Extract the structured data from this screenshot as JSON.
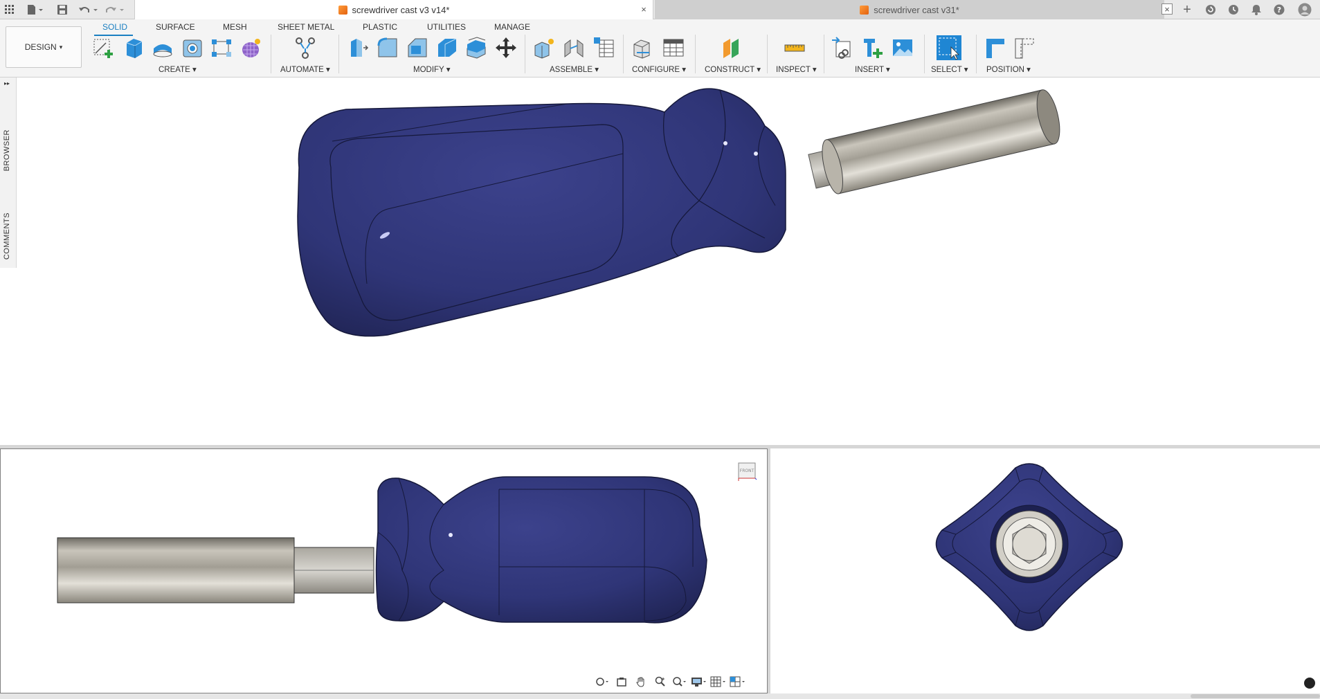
{
  "window": {
    "tabs": [
      {
        "label": "screwdriver cast v3 v14*",
        "active": true
      },
      {
        "label": "screwdriver cast v31*",
        "active": false
      }
    ],
    "close_glyph": "×",
    "new_tab_glyph": "+",
    "right_icons": [
      "refresh-icon",
      "clock-icon",
      "bell-icon",
      "help-icon",
      "user-avatar-icon"
    ]
  },
  "toolbar": {
    "workspace_label": "DESIGN",
    "workspace_arrow": "▾",
    "workspace_tabs": [
      "SOLID",
      "SURFACE",
      "MESH",
      "SHEET METAL",
      "PLASTIC",
      "UTILITIES",
      "MANAGE"
    ],
    "active_tab": "SOLID",
    "groups": {
      "create": "CREATE",
      "automate": "AUTOMATE",
      "modify": "MODIFY",
      "assemble": "ASSEMBLE",
      "configure": "CONFIGURE",
      "construct": "CONSTRUCT",
      "inspect": "INSPECT",
      "insert": "INSERT",
      "select": "SELECT",
      "position": "POSITION"
    },
    "dropdown_glyph": "▾"
  },
  "side_panel": {
    "expand_glyph": "▸▸",
    "browser_label": "BROWSER",
    "comments_label": "COMMENTS"
  },
  "viewcube": {
    "face_label": "FRONT"
  },
  "colors": {
    "handle_blue": "#2f3577",
    "shaft_grey": "#9e9a90",
    "accent": "#1a7fc1",
    "icon_blue": "#2d8fd8"
  }
}
